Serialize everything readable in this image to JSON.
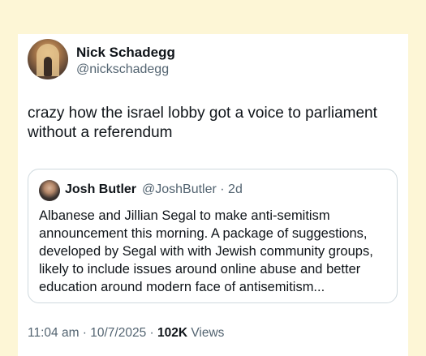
{
  "tweet": {
    "author_name": "Nick Schadegg",
    "author_handle": "@nickschadegg",
    "text": "crazy how the israel lobby got a voice to parliament without a referendum",
    "timestamp": "11:04 am · 10/7/2025 · ",
    "views_count": "102K",
    "views_label": " Views"
  },
  "quoted_tweet": {
    "author_name": "Josh Butler",
    "meta": "@JoshButler · 2d",
    "text": "Albanese and Jillian Segal to make anti-semitism announcement this morning. A package of suggestions, developed by Segal with with Jewish community groups, likely to include issues around online abuse and better education around modern face of antisemitism..."
  }
}
